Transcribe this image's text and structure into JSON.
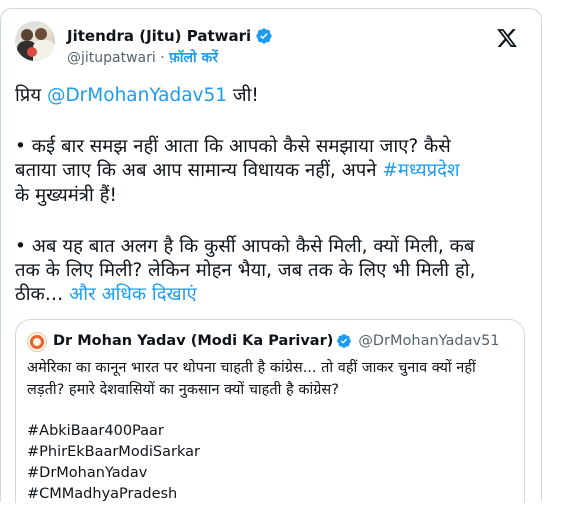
{
  "author": {
    "name": "Jitendra (Jitu) Patwari",
    "handle": "@jitupatwari",
    "separator": "·",
    "follow_label": "फ़ॉलो करें"
  },
  "tweet": {
    "salutation_prefix": "प्रिय ",
    "salutation_mention": "@DrMohanYadav51",
    "salutation_suffix": " जी!",
    "para1_line1": "• कई बार समझ नहीं आता कि आपको कैसे समझाया जाए? कैसे",
    "para1_line2": "बताया जाए कि अब आप सामान्य विधायक नहीं, अपने ",
    "para1_hashtag": "#मध्यप्रदेश",
    "para1_line3": "के मुख्यमंत्री हैं!",
    "para2_line1": "• अब यह बात अलग है कि कुर्सी आपको कैसे मिली, क्यों मिली, कब",
    "para2_line2": "तक के लिए मिली? लेकिन मोहन भैया, जब तक के लिए भी मिली हो,",
    "para2_line3": "ठीक… ",
    "show_more": "और अधिक दिखाएं"
  },
  "quoted": {
    "name": "Dr Mohan Yadav (Modi Ka Parivar)",
    "handle": "@DrMohanYadav51",
    "line1": "अमेरिका का कानून भारत पर थोपना चाहती है कांग्रेस... तो वहीं जाकर चुनाव क्यों नहीं",
    "line2": "लड़ती? हमारे देशवासियों का नुकसान क्यों चाहती है कांग्रेस?",
    "hashtags": [
      "#AbkiBaar400Paar",
      "#PhirEkBaarModiSarkar",
      "#DrMohanYadav",
      "#CMMadhyaPradesh"
    ]
  },
  "colors": {
    "accent": "#1d9bf0",
    "text": "#0f1419",
    "muted": "#536471",
    "border": "#cfd9de"
  },
  "icons": [
    "verified-badge-icon",
    "x-logo-icon"
  ]
}
